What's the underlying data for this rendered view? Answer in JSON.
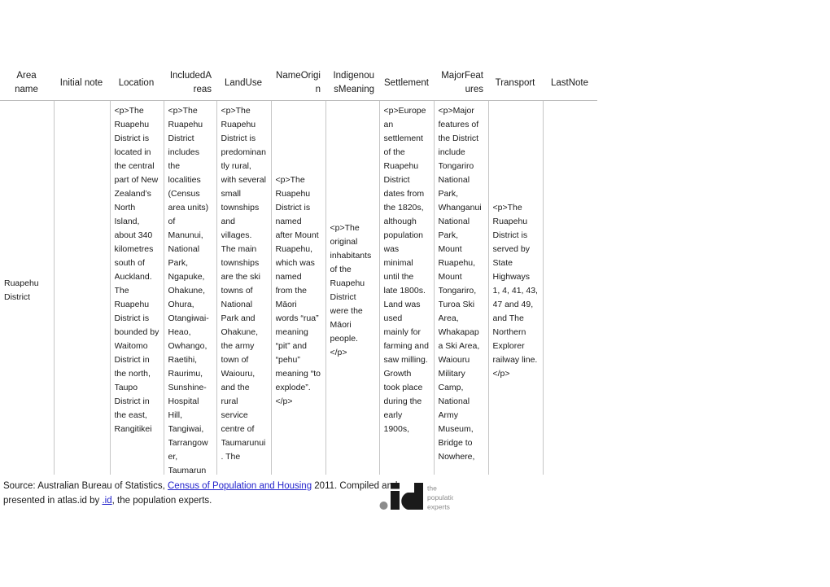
{
  "table": {
    "headers": [
      "Area name",
      "Initial note",
      "Location",
      "IncludedAreas",
      "LandUse",
      "NameOrigin",
      "IndigenousMeaning",
      "Settlement",
      "MajorFeatures",
      "Transport",
      "LastNote"
    ],
    "rows": [
      {
        "area_name": "Ruapehu District",
        "initial_note": "",
        "location": "<p>The Ruapehu District is located in the central part of New Zealand’s North Island, about 340 kilometres south of Auckland. The Ruapehu District is bounded by Waitomo District in the north, Taupo District in the east, Rangitikei",
        "included_areas": "<p>The Ruapehu District includes the localities (Census area units) of Manunui, National Park, Ngapuke, Ohakune, Ohura, Otangiwai-Heao, Owhango, Raetihi, Raurimu, Sunshine-Hospital Hill, Tangiwai, Tarrangower, Taumarun",
        "land_use": "<p>The Ruapehu District is predominantly rural, with several small townships and villages. The main townships are the ski towns of National Park and Ohakune, the army town of Waiouru, and the rural service centre of Taumarunui. The",
        "name_origin": "<p>The Ruapehu District is named after Mount Ruapehu, which was named from the Māori words “rua” meaning “pit” and “pehu” meaning “to explode”.</p>",
        "indigenous_meaning": "<p>The original inhabitants of the Ruapehu District were the Māori people.</p>",
        "settlement": "<p>European settlement of the Ruapehu District dates from the 1820s, although population was minimal until the late 1800s. Land was used mainly for farming and saw milling. Growth took place during the early 1900s,",
        "major_features": "<p>Major features of the District include Tongariro National Park, Whanganui National Park, Mount Ruapehu, Mount Tongariro, Turoa Ski Area, Whakapapa Ski Area, Waiouru Military Camp, National Army Museum, Bridge to Nowhere,",
        "transport": "<p>The Ruapehu District is served by State Highways 1, 4, 41, 43, 47 and 49, and The Northern Explorer railway line.</p>",
        "last_note": ""
      }
    ]
  },
  "footer": {
    "prefix": "Source: Australian Bureau of Statistics, ",
    "link_census": "Census of Population and Housing",
    "middle": " 2011. Compiled and presented in atlas.id by ",
    "link_id": ".id",
    "suffix": ", the population experts."
  },
  "logo": {
    "wordmark": "id",
    "line1": "the",
    "line2": "population",
    "line3": "experts",
    "dark_color": "#1a1a1a",
    "gray_color": "#8c8c8c"
  }
}
